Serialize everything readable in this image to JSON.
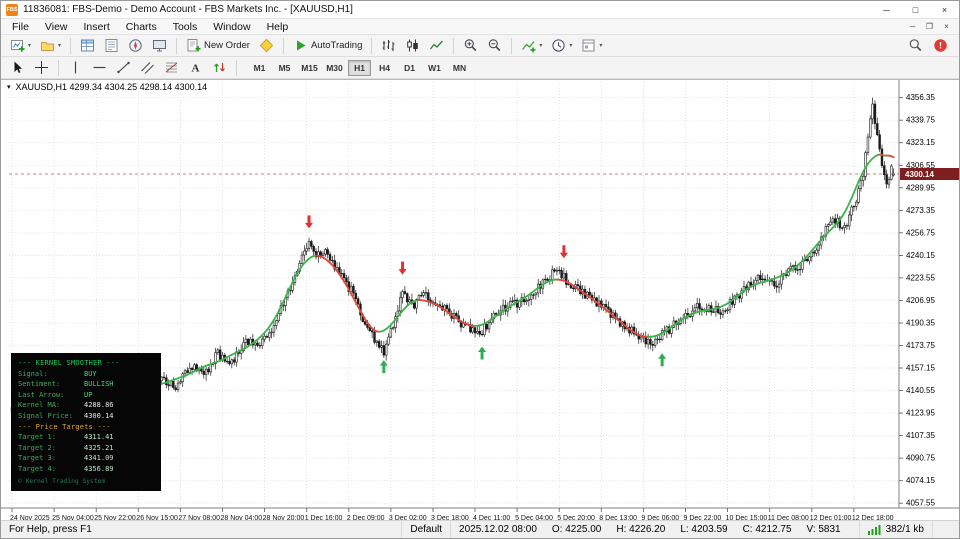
{
  "window": {
    "title": "11836081: FBS-Demo - Demo Account - FBS Markets Inc. - [XAUUSD,H1]",
    "app_icon_label": "FBS"
  },
  "menu": {
    "items": [
      "File",
      "View",
      "Insert",
      "Charts",
      "Tools",
      "Window",
      "Help"
    ]
  },
  "toolbar": {
    "main": [
      {
        "icon": "new-chart",
        "dropdown": true
      },
      {
        "icon": "profiles",
        "dropdown": true
      },
      {
        "sep": true
      },
      {
        "icon": "market-watch"
      },
      {
        "icon": "data-window"
      },
      {
        "icon": "navigator"
      },
      {
        "icon": "terminal"
      },
      {
        "sep": true
      },
      {
        "icon": "new-order",
        "label": "New Order"
      },
      {
        "icon": "metaeditor"
      },
      {
        "sep": true
      },
      {
        "icon": "autotrading",
        "label": "AutoTrading"
      },
      {
        "sep": true
      },
      {
        "icon": "chart-bars"
      },
      {
        "icon": "chart-candles"
      },
      {
        "icon": "chart-line"
      },
      {
        "sep": true
      },
      {
        "icon": "zoom-in"
      },
      {
        "icon": "zoom-out"
      },
      {
        "sep": true
      },
      {
        "icon": "indicators",
        "dropdown": true
      },
      {
        "icon": "periods",
        "dropdown": true
      },
      {
        "icon": "templates",
        "dropdown": true
      }
    ],
    "main_right": [
      {
        "icon": "search"
      },
      {
        "icon": "community"
      }
    ],
    "drawing": [
      {
        "icon": "cursor"
      },
      {
        "icon": "crosshair"
      },
      {
        "sep": true
      },
      {
        "icon": "vertical-line"
      },
      {
        "icon": "horizontal-line"
      },
      {
        "icon": "trendline"
      },
      {
        "icon": "channel"
      },
      {
        "icon": "fibonacci"
      },
      {
        "icon": "text"
      },
      {
        "icon": "arrows"
      },
      {
        "sep": true
      }
    ],
    "timeframes": [
      "M1",
      "M5",
      "M15",
      "M30",
      "H1",
      "H4",
      "D1",
      "W1",
      "MN"
    ],
    "active_timeframe": "H1"
  },
  "chart": {
    "ohlc_line": "XAUUSD,H1 4299.34 4304.25 4298.14 4300.14"
  },
  "info_panel": {
    "title": {
      "text": "--- KERNEL SMOOTHER ---",
      "color": "#17c95d"
    },
    "rows": [
      {
        "label": "Signal:",
        "value": "BUY",
        "label_color": "#3da861",
        "value_color": "#27e06e"
      },
      {
        "label": "Sentiment:",
        "value": "BULLISH",
        "label_color": "#3da861",
        "value_color": "#27e06e"
      },
      {
        "label": "Last Arrow:",
        "value": "UP",
        "label_color": "#3da861",
        "value_color": "#27e06e"
      },
      {
        "label": "Kernel MA:",
        "value": "4288.86",
        "label_color": "#3da861",
        "value_color": "#e8e8e8"
      },
      {
        "label": "Signal Price:",
        "value": "4300.14",
        "label_color": "#3da861",
        "value_color": "#e8e8e8"
      }
    ],
    "targets_title": {
      "text": "--- Price Targets ---",
      "color": "#e4a72b"
    },
    "targets": [
      {
        "label": "Target 1:",
        "value": "4311.41",
        "label_color": "#3da861",
        "value_color": "#bfe8c6"
      },
      {
        "label": "Target 2:",
        "value": "4325.21",
        "label_color": "#3da861",
        "value_color": "#bfe8c6"
      },
      {
        "label": "Target 3:",
        "value": "4341.09",
        "label_color": "#3da861",
        "value_color": "#bfe8c6"
      },
      {
        "label": "Target 4:",
        "value": "4356.89",
        "label_color": "#3da861",
        "value_color": "#bfe8c6"
      }
    ],
    "footer": {
      "text": "© Kernel Trading System",
      "color": "#1d7a50"
    }
  },
  "status_bar": {
    "help_text": "For Help, press F1",
    "template_name": "Default",
    "bar_time": "2025.12.02 08:00",
    "open": "O: 4225.00",
    "high": "H: 4226.20",
    "low": "L: 4203.59",
    "close": "C: 4212.75",
    "volume": "V: 5831",
    "connection": "382/1 kb"
  },
  "chart_data": {
    "type": "candlestick",
    "symbol": "XAUUSD",
    "timeframe": "H1",
    "current_price": 4300.14,
    "last_ohlc": {
      "open": 4299.34,
      "high": 4304.25,
      "low": 4298.14,
      "close": 4300.14
    },
    "y_axis": {
      "min": 4054,
      "max": 4362,
      "ticks": [
        4356.35,
        4339.75,
        4323.15,
        4306.55,
        4289.95,
        4273.35,
        4256.75,
        4240.15,
        4223.55,
        4206.95,
        4190.35,
        4173.75,
        4157.15,
        4140.55,
        4123.95,
        4107.35,
        4090.75,
        4074.15,
        4057.55
      ]
    },
    "x_ticks": [
      "24 Nov 2025",
      "25 Nov 04:00",
      "25 Nov 22:00",
      "26 Nov 15:00",
      "27 Nov 08:00",
      "28 Nov 04:00",
      "28 Nov 20:00",
      "1 Dec 16:00",
      "2 Dec 09:00",
      "3 Dec 02:00",
      "3 Dec 18:00",
      "4 Dec 11:00",
      "5 Dec 04:00",
      "5 Dec 20:00",
      "8 Dec 13:00",
      "9 Dec 06:00",
      "9 Dec 22:00",
      "10 Dec 15:00",
      "11 Dec 08:00",
      "12 Dec 01:00",
      "12 Dec 18:00"
    ],
    "ticks_every": 18,
    "candles_total": 378,
    "price_path": [
      [
        0,
        4128
      ],
      [
        15,
        4142
      ],
      [
        30,
        4135
      ],
      [
        45,
        4148
      ],
      [
        58,
        4140
      ],
      [
        64,
        4150
      ],
      [
        70,
        4142
      ],
      [
        76,
        4160
      ],
      [
        82,
        4152
      ],
      [
        88,
        4168
      ],
      [
        94,
        4160
      ],
      [
        100,
        4178
      ],
      [
        106,
        4172
      ],
      [
        112,
        4190
      ],
      [
        118,
        4212
      ],
      [
        124,
        4240
      ],
      [
        127,
        4250
      ],
      [
        130,
        4238
      ],
      [
        134,
        4246
      ],
      [
        139,
        4228
      ],
      [
        145,
        4214
      ],
      [
        151,
        4190
      ],
      [
        156,
        4176
      ],
      [
        159,
        4170
      ],
      [
        163,
        4190
      ],
      [
        167,
        4214
      ],
      [
        171,
        4202
      ],
      [
        176,
        4212
      ],
      [
        182,
        4204
      ],
      [
        188,
        4196
      ],
      [
        194,
        4188
      ],
      [
        200,
        4182
      ],
      [
        206,
        4196
      ],
      [
        213,
        4203
      ],
      [
        221,
        4209
      ],
      [
        228,
        4221
      ],
      [
        233,
        4232
      ],
      [
        238,
        4219
      ],
      [
        245,
        4212
      ],
      [
        252,
        4202
      ],
      [
        259,
        4192
      ],
      [
        266,
        4183
      ],
      [
        273,
        4176
      ],
      [
        280,
        4184
      ],
      [
        287,
        4196
      ],
      [
        295,
        4203
      ],
      [
        303,
        4198
      ],
      [
        311,
        4212
      ],
      [
        319,
        4224
      ],
      [
        326,
        4218
      ],
      [
        333,
        4229
      ],
      [
        340,
        4236
      ],
      [
        346,
        4252
      ],
      [
        351,
        4268
      ],
      [
        356,
        4261
      ],
      [
        361,
        4282
      ],
      [
        364,
        4300
      ],
      [
        366,
        4330
      ],
      [
        368,
        4350
      ],
      [
        370,
        4331
      ],
      [
        372,
        4306
      ],
      [
        374,
        4293
      ],
      [
        376,
        4304
      ],
      [
        377,
        4300.14
      ]
    ],
    "high_marker": {
      "index": 368,
      "price": 4356.35
    },
    "arrows": [
      {
        "index": 127,
        "dir": "down",
        "price": 4260
      },
      {
        "index": 167,
        "dir": "down",
        "price": 4226
      },
      {
        "index": 236,
        "dir": "down",
        "price": 4238
      },
      {
        "index": 159,
        "dir": "up",
        "price": 4163
      },
      {
        "index": 201,
        "dir": "up",
        "price": 4173
      },
      {
        "index": 278,
        "dir": "up",
        "price": 4168
      }
    ],
    "ma": {
      "name": "Kernel Smoother",
      "colors": {
        "up": "#3cb54a",
        "down": "#e0493c"
      }
    },
    "arrow_colors": {
      "up": "#2fae50",
      "down": "#e03030"
    },
    "bid_badge_color": "#7d1f1f"
  }
}
